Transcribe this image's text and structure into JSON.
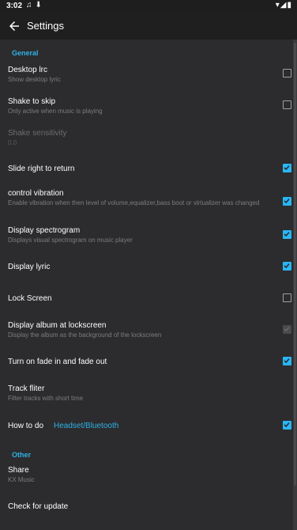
{
  "status": {
    "time": "3:02",
    "notifications": [
      "♫",
      "⬇"
    ],
    "right_icons": "▾◢▮"
  },
  "appbar": {
    "title": "Settings"
  },
  "sections": {
    "general": "General",
    "other": "Other"
  },
  "items": {
    "desktop_lrc": {
      "title": "Desktop lrc",
      "subtitle": "Show desktop lyric",
      "checked": false
    },
    "shake_to_skip": {
      "title": "Shake to skip",
      "subtitle": "Only active when music is playing",
      "checked": false
    },
    "shake_sensitivity": {
      "title": "Shake sensitivity",
      "subtitle": "0.0"
    },
    "slide_right": {
      "title": "Slide right to return",
      "checked": true
    },
    "control_vibration": {
      "title": "control vibration",
      "subtitle": "Enable vibration when then level of volume,equalizer,bass boot or virtualizer was changed",
      "checked": true
    },
    "display_spectrogram": {
      "title": "Display spectrogram",
      "subtitle": "Displays visual spectrogram on music player",
      "checked": true
    },
    "display_lyric": {
      "title": "Display lyric",
      "checked": true
    },
    "lock_screen": {
      "title": "Lock Screen",
      "checked": false
    },
    "album_lockscreen": {
      "title": "Display album at lockscreen",
      "subtitle": "Display the album as the background of the lockscreen",
      "checked": true,
      "disabled": true
    },
    "fade": {
      "title": "Turn on fade in and fade out",
      "checked": true
    },
    "track_filter": {
      "title": "Track fliter",
      "subtitle": "Filter tracks with short time"
    },
    "how_to_do": {
      "title": "How to do",
      "value": "Headset/Bluetooth",
      "checked": true
    },
    "share": {
      "title": "Share",
      "subtitle": "KX Music"
    },
    "check_update": {
      "title": "Check for update"
    }
  },
  "colors": {
    "accent": "#29b6f6",
    "background": "#2c2c2e",
    "appbar": "#1f1f1f"
  }
}
